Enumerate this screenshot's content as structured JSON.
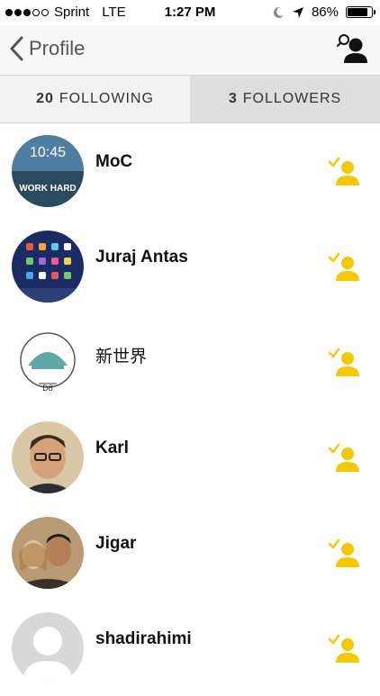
{
  "status_bar": {
    "carrier": "Sprint",
    "network": "LTE",
    "time": "1:27 PM",
    "battery_percent": "86%",
    "battery_level": 0.86,
    "signal_bars_filled": 3,
    "signal_bars_total": 5
  },
  "nav": {
    "back_label": "Profile",
    "back_icon": "chevron-left-icon",
    "action_icon": "find-user-icon"
  },
  "tabs": {
    "following_count": "20",
    "following_label": "FOLLOWING",
    "followers_count": "3",
    "followers_label": "FOLLOWERS"
  },
  "users": [
    {
      "name": "MoC",
      "avatar_text": "WORK HARD",
      "avatar_time": "10:45"
    },
    {
      "name": "Juraj Antas"
    },
    {
      "name": "新世界",
      "avatar_text": "D8"
    },
    {
      "name": "Karl"
    },
    {
      "name": "Jigar"
    },
    {
      "name": "shadirahimi"
    }
  ],
  "colors": {
    "accent": "#f6c800",
    "nav_bg": "#f7f7f7",
    "tab_active_bg": "#f2f2f2",
    "tab_inactive_bg": "#dedede"
  }
}
